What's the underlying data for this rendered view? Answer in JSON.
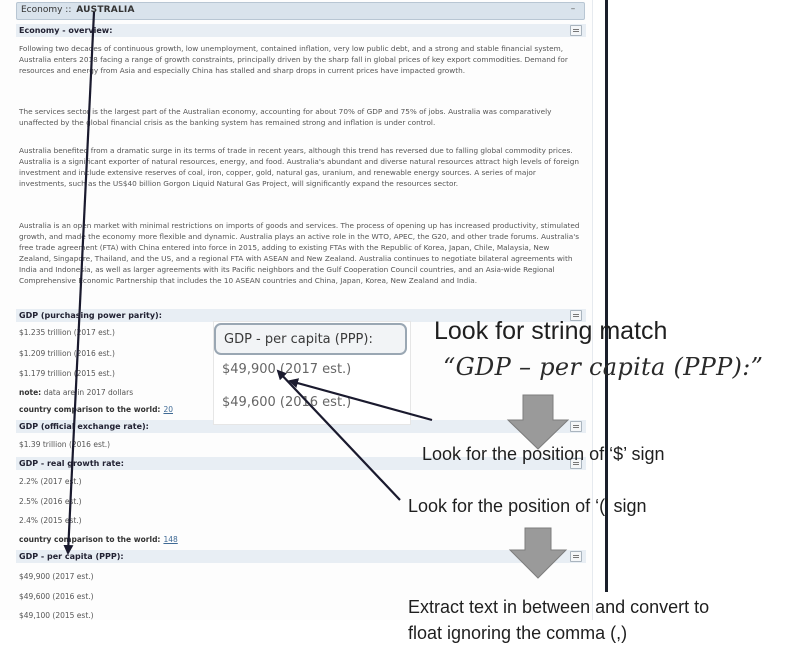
{
  "panel": {
    "tab_prefix": "Economy ::",
    "country": "AUSTRALIA",
    "collapse_symbol": "–",
    "overview_heading": "Economy - overview:",
    "paragraphs": [
      "Following two decades of continuous growth, low unemployment, contained inflation, very low public debt, and a strong and stable financial system, Australia enters 2018 facing a range of growth constraints, principally driven by the sharp fall in global prices of key export commodities. Demand for resources and energy from Asia and especially China has stalled and sharp drops in current prices have impacted growth.",
      "The services sector is the largest part of the Australian economy, accounting for about 70% of GDP and 75% of jobs. Australia was comparatively unaffected by the global financial crisis as the banking system has remained strong and inflation is under control.",
      "Australia benefited from a dramatic surge in its terms of trade in recent years, although this trend has reversed due to falling global commodity prices. Australia is a significant exporter of natural resources, energy, and food. Australia's abundant and diverse natural resources attract high levels of foreign investment and include extensive reserves of coal, iron, copper, gold, natural gas, uranium, and renewable energy sources. A series of major investments, such as the US$40 billion Gorgon Liquid Natural Gas Project, will significantly expand the resources sector.",
      "Australia is an open market with minimal restrictions on imports of goods and services. The process of opening up has increased productivity, stimulated growth, and made the economy more flexible and dynamic. Australia plays an active role in the WTO, APEC, the G20, and other trade forums. Australia's free trade agreement (FTA) with China entered into force in 2015, adding to existing FTAs with the Republic of Korea, Japan, Chile, Malaysia, New Zealand, Singapore, Thailand, and the US, and a regional FTA with ASEAN and New Zealand. Australia continues to negotiate bilateral agreements with India and Indonesia, as well as larger agreements with its Pacific neighbors and the Gulf Cooperation Council countries, and an Asia-wide Regional Comprehensive Economic Partnership that includes the 10 ASEAN countries and China, Japan, Korea, New Zealand and India."
    ],
    "ppp": {
      "heading": "GDP (purchasing power parity):",
      "values": [
        "$1.235 trillion (2017 est.)",
        "$1.209 trillion (2016 est.)",
        "$1.179 trillion (2015 est.)"
      ],
      "note_label": "note:",
      "note_text": "data are in 2017 dollars",
      "rank_label": "country comparison to the world:",
      "rank_value": "20"
    },
    "official": {
      "heading": "GDP (official exchange rate):",
      "values": [
        "$1.39 trillion (2016 est.)"
      ]
    },
    "growth": {
      "heading": "GDP - real growth rate:",
      "values": [
        "2.2% (2017 est.)",
        "2.5% (2016 est.)",
        "2.4% (2015 est.)"
      ],
      "rank_label": "country comparison to the world:",
      "rank_value": "148"
    },
    "per_capita": {
      "heading": "GDP - per capita (PPP):",
      "values": [
        "$49,900 (2017 est.)",
        "$49,600 (2016 est.)",
        "$49,100 (2015 est.)"
      ]
    }
  },
  "zoom": {
    "label": "GDP - per capita (PPP):",
    "values": [
      "$49,900 (2017 est.)",
      "$49,600 (2016 est.)"
    ]
  },
  "annotations": {
    "step1_title": "Look for string match",
    "step1_match": "“GDP – per capita (PPP):”",
    "step2": "Look for the position of ‘$’ sign",
    "step3": "Look for the position of ‘(’ sign",
    "step4_line1": "Extract text in between and convert to",
    "step4_line2": "float ignoring the comma (,)"
  },
  "colors": {
    "section_bg": "#e8eef4",
    "arrow": "#1a1a2e",
    "block_arrow": "#9a9a9a",
    "divider": "#1a1f2a"
  }
}
